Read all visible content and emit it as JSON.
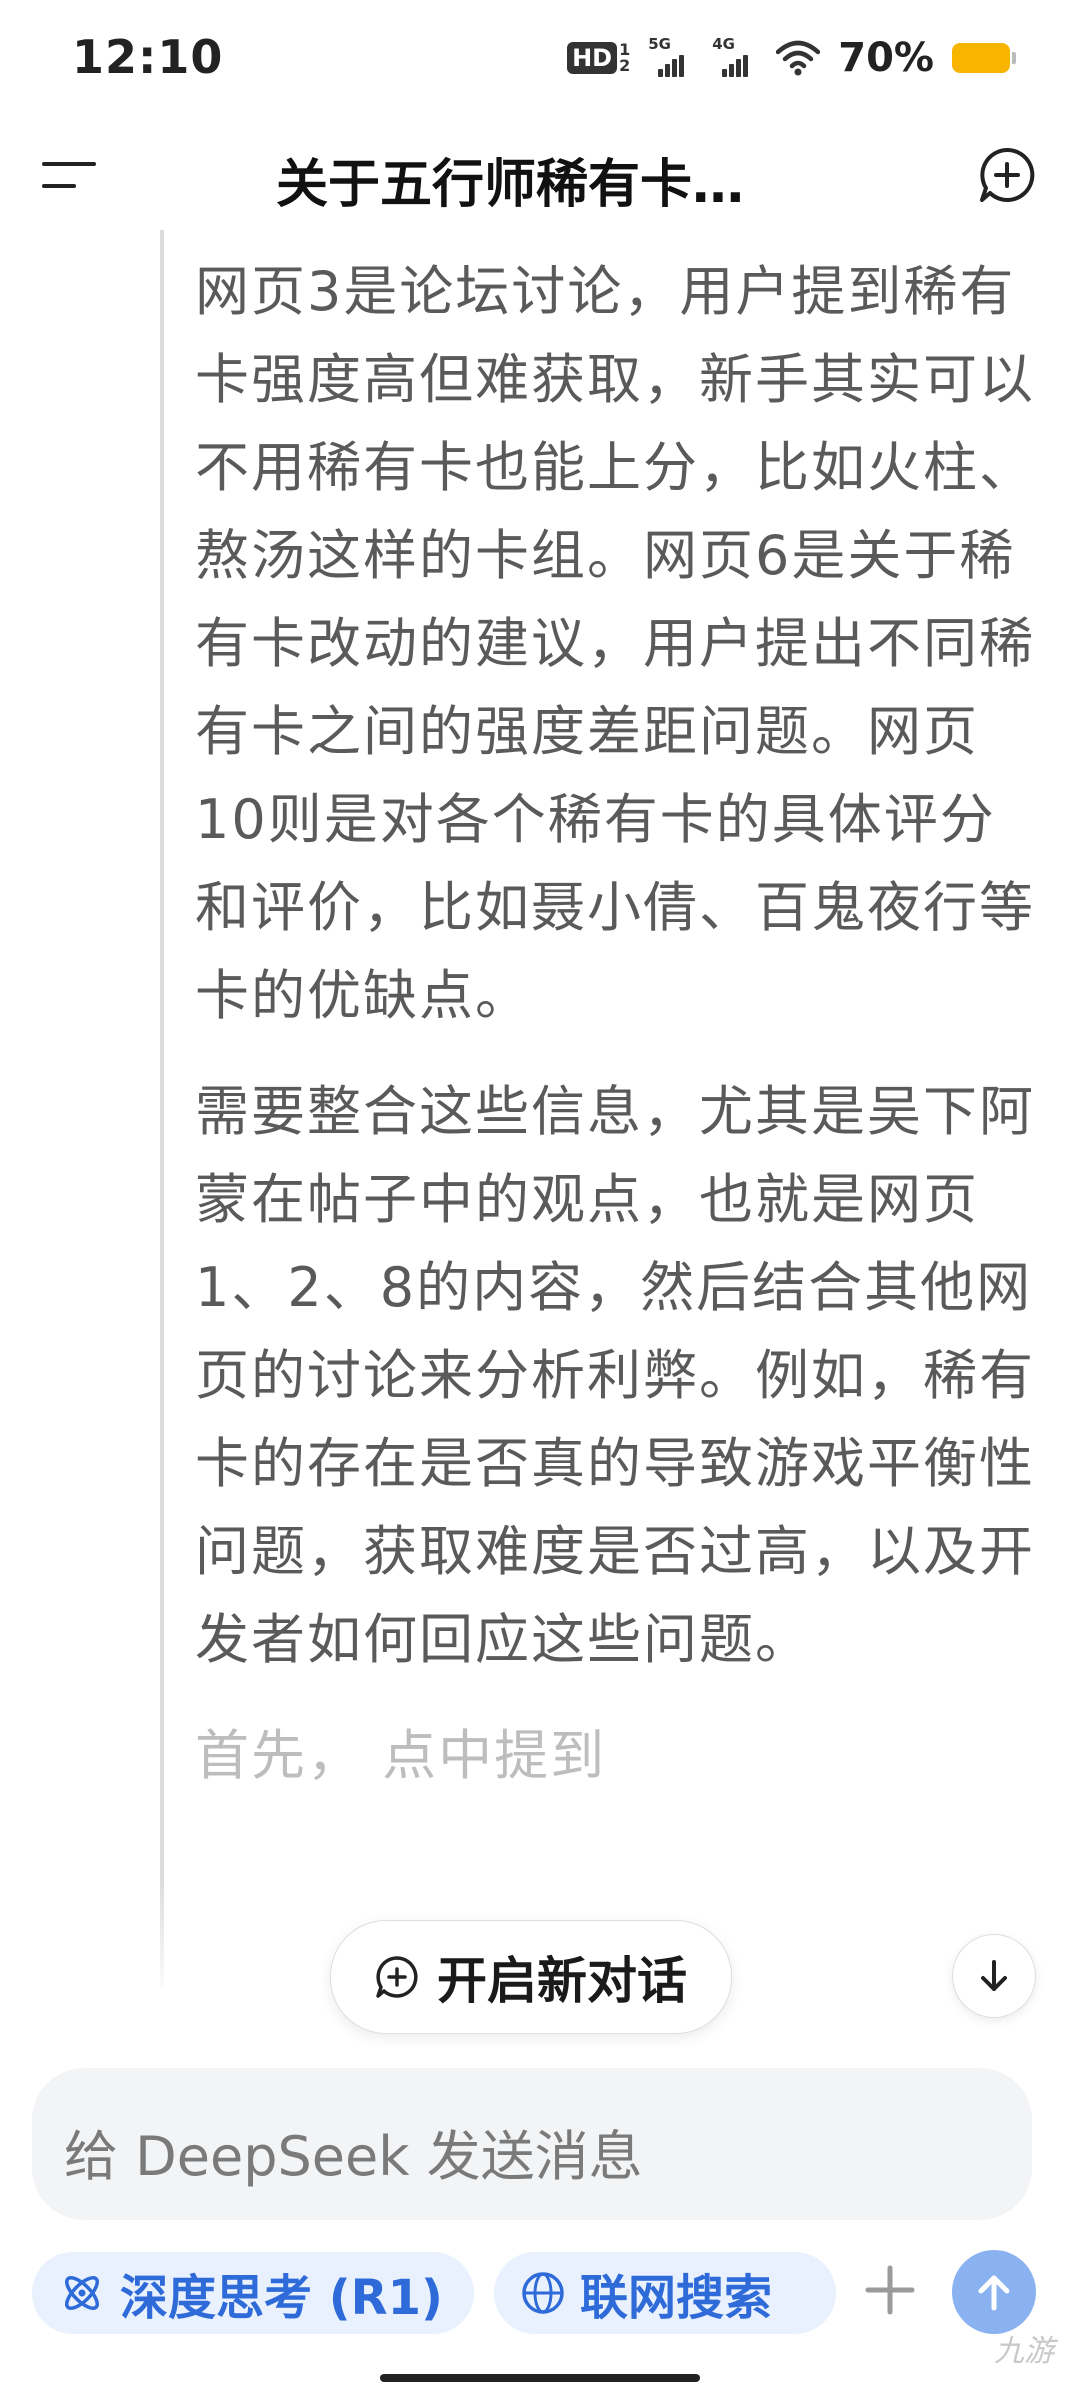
{
  "status_bar": {
    "time": "12:10",
    "hd_label": "HD",
    "hd_sub_top": "1",
    "hd_sub_bottom": "2",
    "signal1_tag": "5G",
    "signal2_tag": "4G",
    "battery_text": "70%",
    "battery_color": "#f7b500"
  },
  "header": {
    "title": "关于五行师稀有卡…",
    "menu_icon": "menu-icon",
    "new_chat_icon": "new-chat-icon"
  },
  "content": {
    "paragraphs": [
      "网页3是论坛讨论，用户提到稀有卡强度高但难获取，新手其实可以不用稀有卡也能上分，比如火柱、熬汤这样的卡组。网页6是关于稀有卡改动的建议，用户提出不同稀有卡之间的强度差距问题。网页10则是对各个稀有卡的具体评分和评价，比如聂小倩、百鬼夜行等卡的优缺点。",
      "需要整合这些信息，尤其是吴下阿蒙在帖子中的观点，也就是网页1、2、8的内容，然后结合其他网页的讨论来分析利弊。例如，稀有卡的存在是否真的导致游戏平衡性问题，获取难度是否过高，以及开发者如何回应这些问题。",
      "首先，            点中提到"
    ]
  },
  "new_chat_pill": {
    "label": "开启新对话"
  },
  "input": {
    "placeholder": "给 DeepSeek 发送消息"
  },
  "toolbar": {
    "deep_think_label": "深度思考 (R1)",
    "web_search_label": "联网搜索",
    "accent_color": "#2f6ad9",
    "send_color": "#8ab2f0"
  },
  "watermark": "九游"
}
